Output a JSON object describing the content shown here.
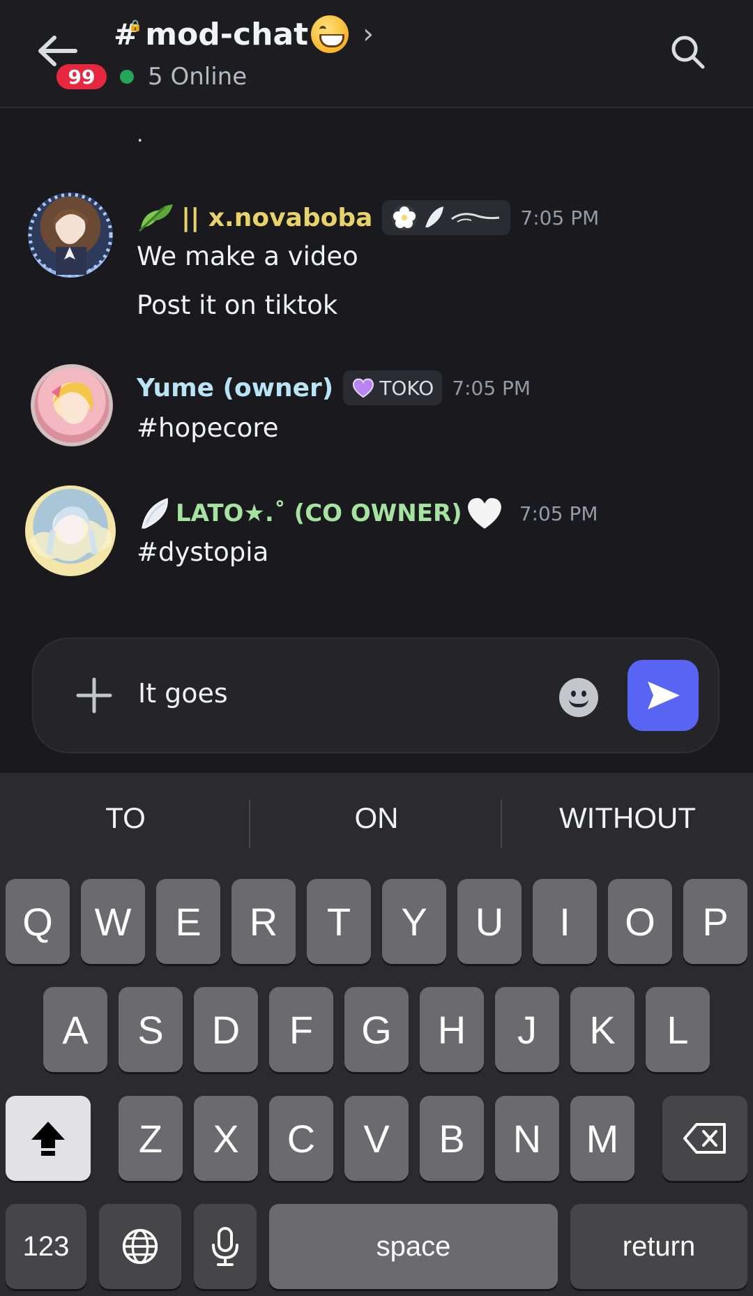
{
  "header": {
    "channel_hash": "#",
    "channel_name": "mod-chat",
    "channel_emoji": "grinning-face-emoji",
    "chevron": "›",
    "badge_count": "99",
    "online_text": "5 Online",
    "status_color": "#23a55a"
  },
  "messages": {
    "stray_line": ".",
    "list": [
      {
        "username": "|| x.novaboba",
        "username_color": "#e8d36b",
        "tag_icons": [
          "flower-icon",
          "wing-icon",
          "swirl-icon"
        ],
        "time": "7:05 PM",
        "lines": [
          "We make a video",
          "Post it on tiktok"
        ]
      },
      {
        "username": "Yume (owner)",
        "username_color": "#b9e4f5",
        "tag_icon": "purple-heart-icon",
        "tag_text": "TOKO",
        "time": "7:05 PM",
        "lines": [
          "#hopecore"
        ]
      },
      {
        "username": "LATO★.˚ (CO OWNER)",
        "username_color": "#a6e3a1",
        "trailing_emoji": "white-heart-icon",
        "time": "7:05 PM",
        "lines": [
          "#dystopia"
        ]
      }
    ]
  },
  "composer": {
    "value": "It goes",
    "accent": "#5865f2"
  },
  "keyboard": {
    "suggestions": [
      "TO",
      "ON",
      "WITHOUT"
    ],
    "row1": [
      "Q",
      "W",
      "E",
      "R",
      "T",
      "Y",
      "U",
      "I",
      "O",
      "P"
    ],
    "row2": [
      "A",
      "S",
      "D",
      "F",
      "G",
      "H",
      "J",
      "K",
      "L"
    ],
    "row3": [
      "Z",
      "X",
      "C",
      "V",
      "B",
      "N",
      "M"
    ],
    "numbers_label": "123",
    "space_label": "space",
    "return_label": "return"
  }
}
